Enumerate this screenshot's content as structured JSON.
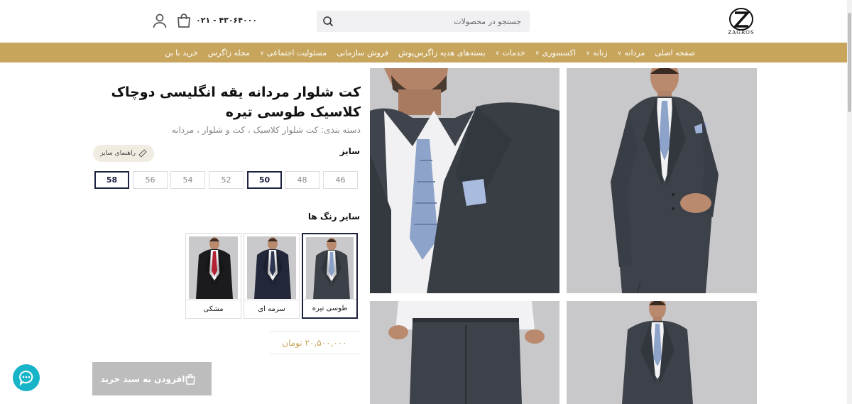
{
  "header": {
    "logo_text": "ZAGROS",
    "search_placeholder": "جستجو در محصولات",
    "phone": "۰۲۱ - ۴۳۰۶۴۰۰۰"
  },
  "nav": {
    "items": [
      {
        "label": "صفحه اصلی",
        "dropdown": false
      },
      {
        "label": "مردانه",
        "dropdown": true
      },
      {
        "label": "زنانه",
        "dropdown": true
      },
      {
        "label": "اکسسوری",
        "dropdown": true
      },
      {
        "label": "خدمات",
        "dropdown": true
      },
      {
        "label": "بسته‌های هدیه زاگرس‌پوش",
        "dropdown": false
      },
      {
        "label": "فروش سازمانی",
        "dropdown": false
      },
      {
        "label": "مسئولیت اجتماعی",
        "dropdown": true
      },
      {
        "label": "مجله زاگرس",
        "dropdown": false
      },
      {
        "label": "خرید با بن",
        "dropdown": false
      }
    ]
  },
  "product": {
    "title": "کت شلوار مردانه یقه انگلیسی دوچاک کلاسیک طوسی تیره",
    "category": "دسته بندی: کت شلوار کلاسیک ، کت و شلوار ، مردانه",
    "size_label": "سایز",
    "size_guide_label": "راهنمای سایز",
    "sizes": [
      "46",
      "48",
      "50",
      "52",
      "54",
      "56",
      "58"
    ],
    "selected_sizes": [
      "50",
      "58"
    ],
    "colors_label": "سایر رنگ ها",
    "colors": [
      {
        "label": "طوسی تیره",
        "selected": true,
        "suit": "#3c4048",
        "tie": "#8aa0c8"
      },
      {
        "label": "سرمه ای",
        "selected": false,
        "suit": "#22283a",
        "tie": "#2d3550"
      },
      {
        "label": "مشکی",
        "selected": false,
        "suit": "#1b1b1d",
        "tie": "#b22234"
      }
    ],
    "price": "۲۰,۵۰۰,۰۰۰ تومان",
    "add_to_cart_label": "افزودن به سبد خرید"
  },
  "colors": {
    "accent": "#c7a55c",
    "nav_bar": "#c7a55c",
    "selected_border": "#1d2340",
    "chat_button": "#16b3c9",
    "disabled_button": "#bdbdbd"
  }
}
